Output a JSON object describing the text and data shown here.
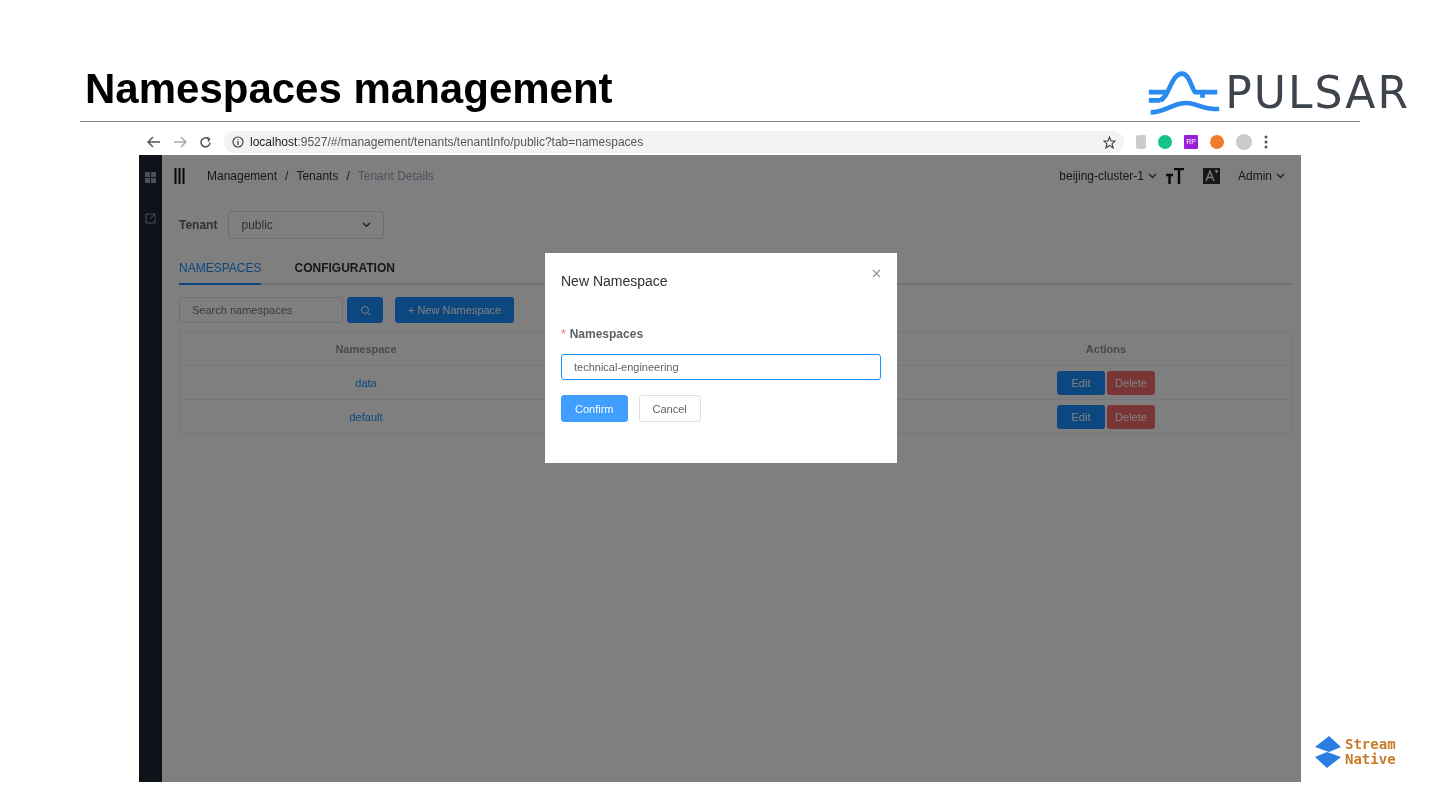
{
  "slide": {
    "title": "Namespaces management",
    "logo_text": "PULSAR",
    "footer_logo": [
      "Stream",
      "Native"
    ]
  },
  "browser": {
    "url_host": "localhost",
    "url_rest": ":9527/#/management/tenants/tenantInfo/public?tab=namespaces",
    "extension_label": "RP"
  },
  "header": {
    "breadcrumbs": [
      {
        "label": "Management",
        "current": false
      },
      {
        "label": "Tenants",
        "current": false
      },
      {
        "label": "Tenant Details",
        "current": true
      }
    ],
    "separator": "/",
    "cluster": "beijing-cluster-1",
    "user": "Admin"
  },
  "tenant": {
    "label": "Tenant",
    "value": "public"
  },
  "tabs": [
    {
      "label": "NAMESPACES",
      "selected": true
    },
    {
      "label": "CONFIGURATION",
      "selected": false
    }
  ],
  "search": {
    "placeholder": "Search namespaces"
  },
  "new_button": "+ New Namespace",
  "table": {
    "columns": [
      "Namespace",
      "Actions"
    ],
    "rows": [
      {
        "namespace": "data",
        "actions": [
          "Edit",
          "Delete"
        ]
      },
      {
        "namespace": "default",
        "actions": [
          "Edit",
          "Delete"
        ]
      }
    ]
  },
  "dialog": {
    "title": "New Namespace",
    "required_mark": "*",
    "field_label": "Namespaces",
    "field_value": "technical-engineering",
    "buttons": [
      {
        "label": "Confirm",
        "kind": "primary"
      },
      {
        "label": "Cancel",
        "kind": "default"
      }
    ]
  }
}
